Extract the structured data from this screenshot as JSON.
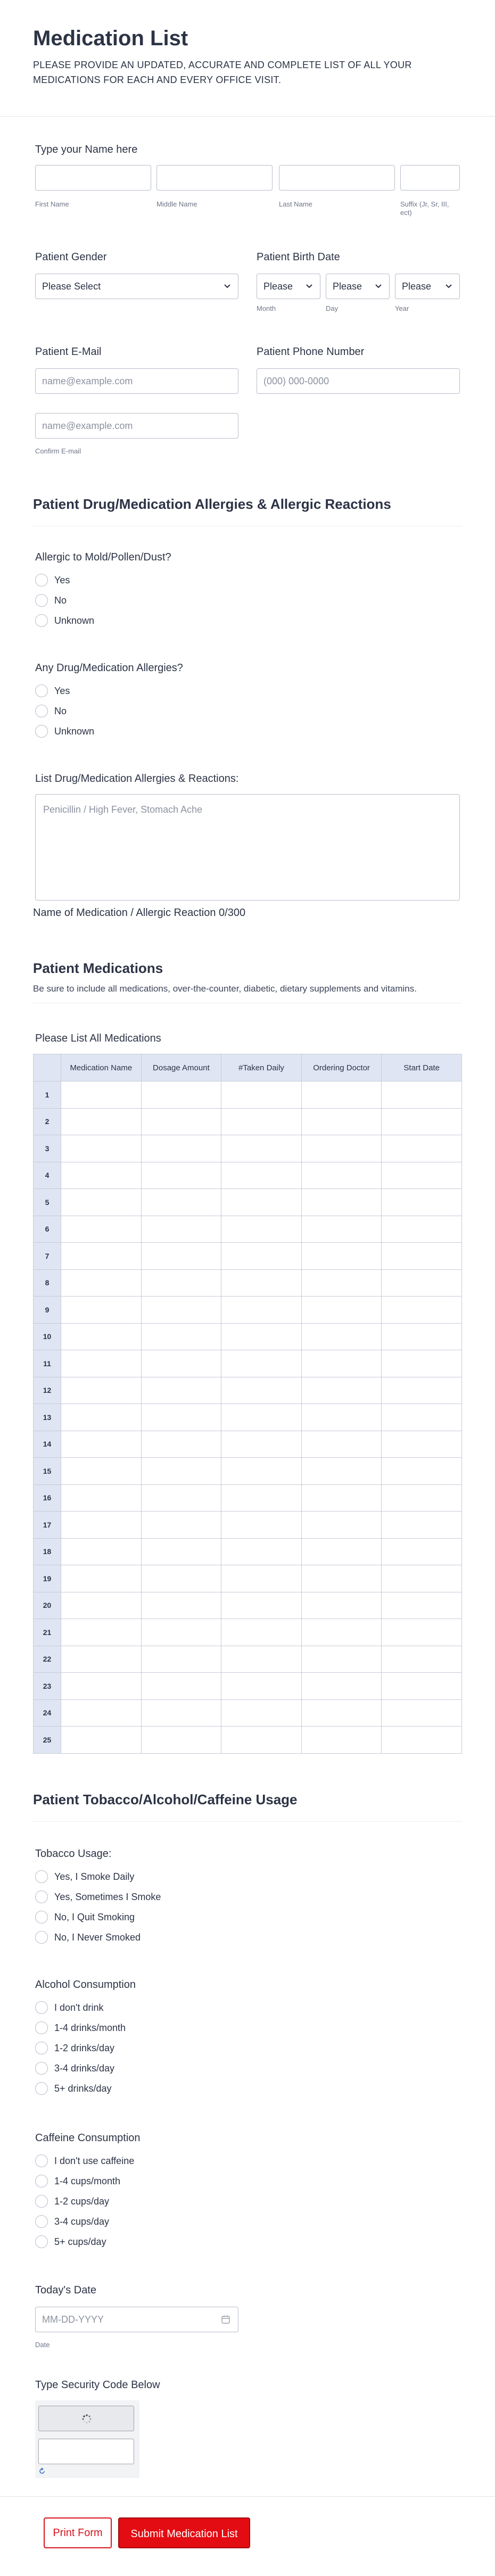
{
  "header": {
    "title": "Medication List",
    "subtitle": "PLEASE PROVIDE AN UPDATED, ACCURATE AND COMPLETE LIST OF ALL YOUR MEDICATIONS FOR EACH AND EVERY OFFICE VISIT."
  },
  "name_field": {
    "label": "Type your Name here",
    "first": "First Name",
    "middle": "Middle Name",
    "last": "Last Name",
    "suffix": "Suffix (Jr, Sr, III, ect)"
  },
  "gender": {
    "label": "Patient Gender",
    "value": "Please Select"
  },
  "birth": {
    "label": "Patient Birth Date",
    "month": "Please",
    "day": "Please",
    "year": "Please",
    "month_label": "Month",
    "day_label": "Day",
    "year_label": "Year"
  },
  "email": {
    "label": "Patient E-Mail",
    "placeholder": "name@example.com",
    "confirm_placeholder": "name@example.com",
    "confirm_label": "Confirm E-mail"
  },
  "phone": {
    "label": "Patient Phone Number",
    "placeholder": "(000) 000-0000"
  },
  "allergies_section": {
    "title": "Patient Drug/Medication Allergies & Allergic Reactions",
    "mold_label": "Allergic to Mold/Pollen/Dust?",
    "mold_options": [
      "Yes",
      "No",
      "Unknown"
    ],
    "drug_label": "Any Drug/Medication Allergies?",
    "drug_options": [
      "Yes",
      "No",
      "Unknown"
    ],
    "list_label": "List Drug/Medication Allergies & Reactions:",
    "list_placeholder": "Penicillin / High Fever, Stomach Ache",
    "counter": "Name of Medication / Allergic Reaction 0/300"
  },
  "medications_section": {
    "title": "Patient Medications",
    "subtitle": "Be sure to include all medications, over-the-counter, diabetic, dietary supplements and vitamins.",
    "table_label": "Please List All Medications",
    "columns": [
      "Medication Name",
      "Dosage Amount",
      "#Taken Daily",
      "Ordering Doctor",
      "Start Date"
    ],
    "rows": [
      "1",
      "2",
      "3",
      "4",
      "5",
      "6",
      "7",
      "8",
      "9",
      "10",
      "11",
      "12",
      "13",
      "14",
      "15",
      "16",
      "17",
      "18",
      "19",
      "20",
      "21",
      "22",
      "23",
      "24",
      "25"
    ]
  },
  "usage_section": {
    "title": "Patient Tobacco/Alcohol/Caffeine Usage",
    "tobacco_label": "Tobacco Usage:",
    "tobacco_options": [
      "Yes, I Smoke Daily",
      "Yes, Sometimes I Smoke",
      "No, I Quit Smoking",
      "No, I Never Smoked"
    ],
    "alcohol_label": "Alcohol Consumption",
    "alcohol_options": [
      "I don't drink",
      "1-4 drinks/month",
      "1-2 drinks/day",
      "3-4 drinks/day",
      "5+ drinks/day"
    ],
    "caffeine_label": "Caffeine Consumption",
    "caffeine_options": [
      "I don't use caffeine",
      "1-4 cups/month",
      "1-2 cups/day",
      "3-4 cups/day",
      "5+ cups/day"
    ]
  },
  "date": {
    "label": "Today's Date",
    "placeholder": "MM-DD-YYYY",
    "sublabel": "Date"
  },
  "captcha": {
    "label": "Type Security Code Below"
  },
  "buttons": {
    "print": "Print Form",
    "submit": "Submit Medication List"
  },
  "colors": {
    "accent": "#e30c12",
    "table_header": "#dfe5f3",
    "border": "#b8bdc9"
  }
}
